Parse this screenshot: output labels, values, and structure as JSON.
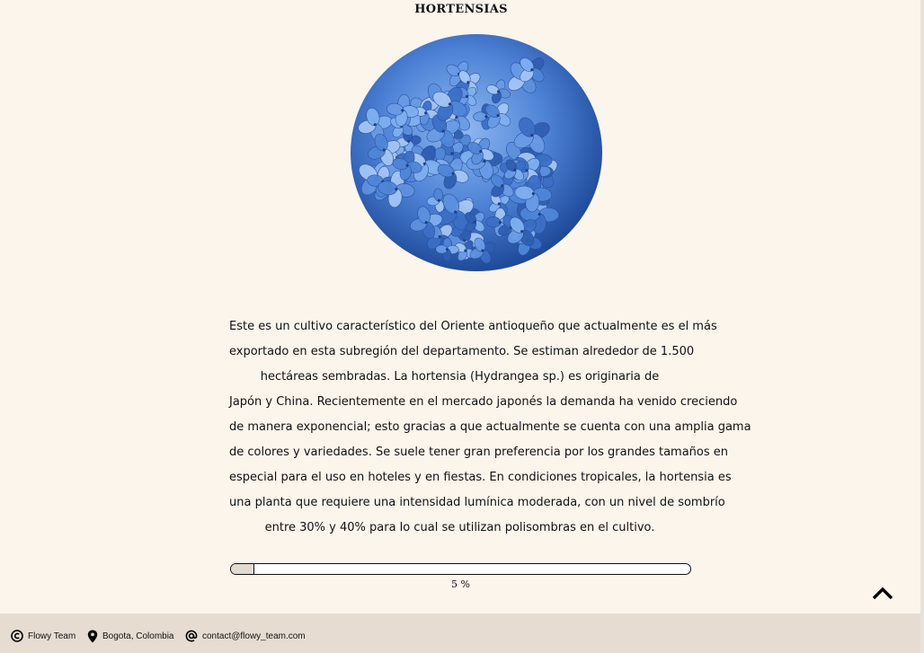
{
  "page": {
    "title": "HORTENSIAS"
  },
  "image": {
    "icon": "hydrangea-flower-image",
    "color": "#4f86d8"
  },
  "description": {
    "lines": [
      "Este es un cultivo característico del Oriente antioqueño que actualmente es el más",
      "exportado en esta subregión del departamento. Se estiman alrededor de 1.500",
      "hectáreas sembradas. La hortensia (Hydrangea sp.) es originaria de",
      "Japón y China. Recientemente en el mercado japonés la demanda ha venido creciendo",
      "de manera exponencial; esto gracias a que actualmente se cuenta con una amplia gama",
      "de colores y variedades. Se suele tener gran preferencia por los grandes tamaños en",
      "especial para el uso en hoteles y en fiestas. En condiciones tropicales, la hortensia es",
      "una planta que requiere una intensidad lumínica moderada, con un nivel de sombrío",
      "entre 30% y 40% para lo cual se utilizan polisombras en el cultivo."
    ]
  },
  "progress": {
    "value_percent": 5,
    "label": "5 %",
    "fill_color": "#e2d9cf"
  },
  "scroll_top": {
    "icon": "chevron-up-icon"
  },
  "footer": {
    "copyright": {
      "icon": "copyright-icon",
      "text": "Flowy Team"
    },
    "location": {
      "icon": "location-pin-icon",
      "text": "Bogota, Colombia"
    },
    "contact": {
      "icon": "at-sign-icon",
      "text": "contact@flowy_team.com"
    }
  },
  "colors": {
    "background": "#fcf5ec",
    "footer_background": "#e6dcd2"
  }
}
